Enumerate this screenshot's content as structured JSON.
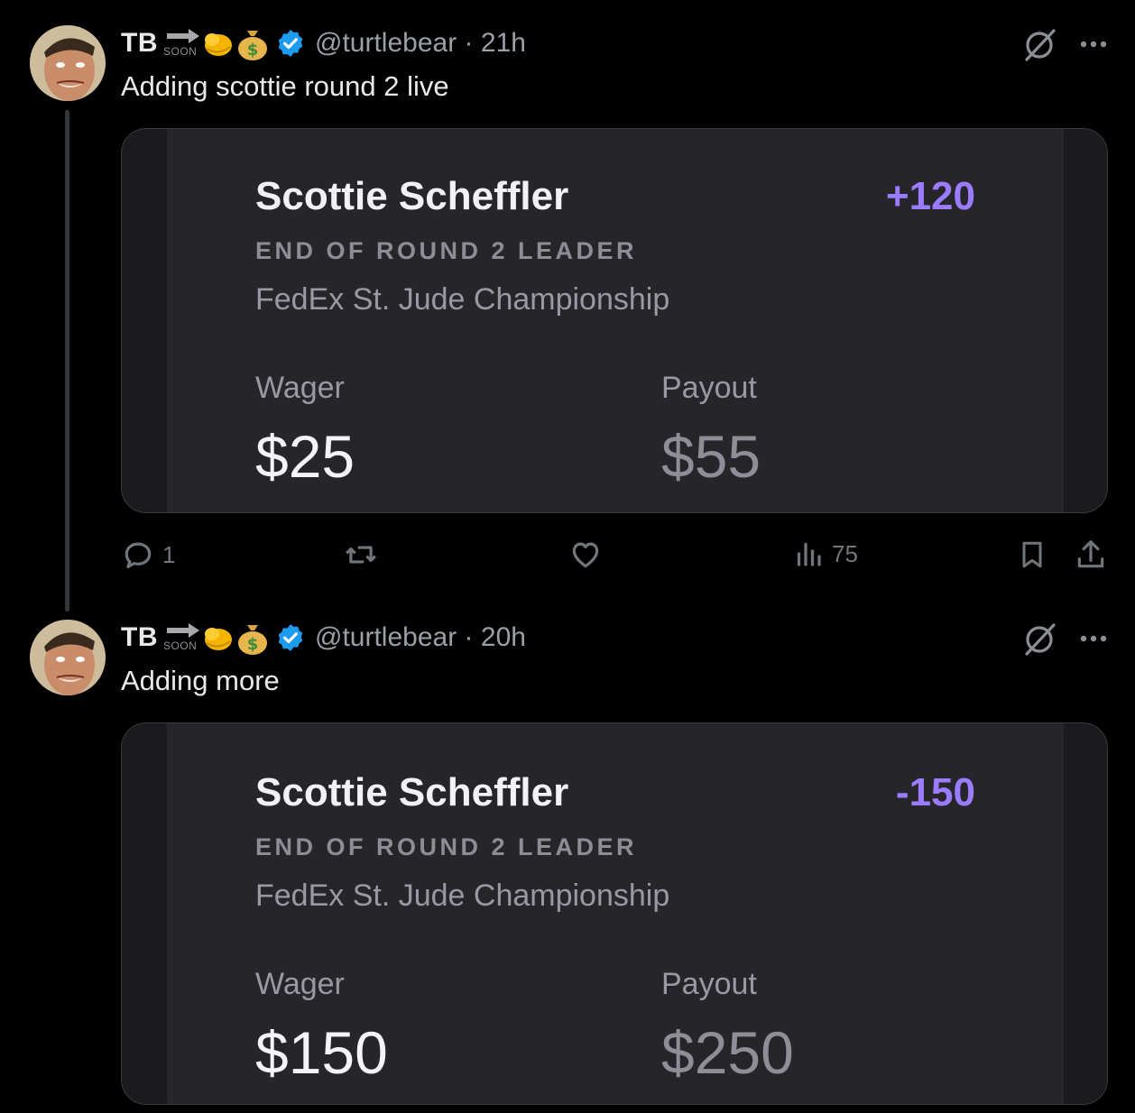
{
  "tweets": [
    {
      "display_name": "TB",
      "soon_badge": "SOON",
      "handle": "@turtlebear",
      "separator": "·",
      "time": "21h",
      "text": "Adding scottie round 2 live",
      "bet": {
        "player": "Scottie Scheffler",
        "odds": "+120",
        "market": "END OF ROUND 2 LEADER",
        "event": "FedEx St. Jude Championship",
        "wager_label": "Wager",
        "wager": "$25",
        "payout_label": "Payout",
        "payout": "$55"
      },
      "actions": {
        "replies": "1",
        "views": "75"
      }
    },
    {
      "display_name": "TB",
      "soon_badge": "SOON",
      "handle": "@turtlebear",
      "separator": "·",
      "time": "20h",
      "text": "Adding more",
      "bet": {
        "player": "Scottie Scheffler",
        "odds": "-150",
        "market": "END OF ROUND 2 LEADER",
        "event": "FedEx St. Jude Championship",
        "wager_label": "Wager",
        "wager": "$150",
        "payout_label": "Payout",
        "payout": "$250"
      }
    }
  ],
  "colors": {
    "background": "#000000",
    "card": "#26252a",
    "odds": "#9b7bff",
    "verified": "#1d9bf0",
    "muted": "#71767b"
  },
  "icons": [
    "arrow-right-icon",
    "flexed-arm-emoji",
    "money-bag-emoji",
    "verified-badge-icon",
    "grok-icon",
    "more-icon",
    "reply-icon",
    "retweet-icon",
    "like-icon",
    "views-icon",
    "bookmark-icon",
    "share-icon"
  ]
}
